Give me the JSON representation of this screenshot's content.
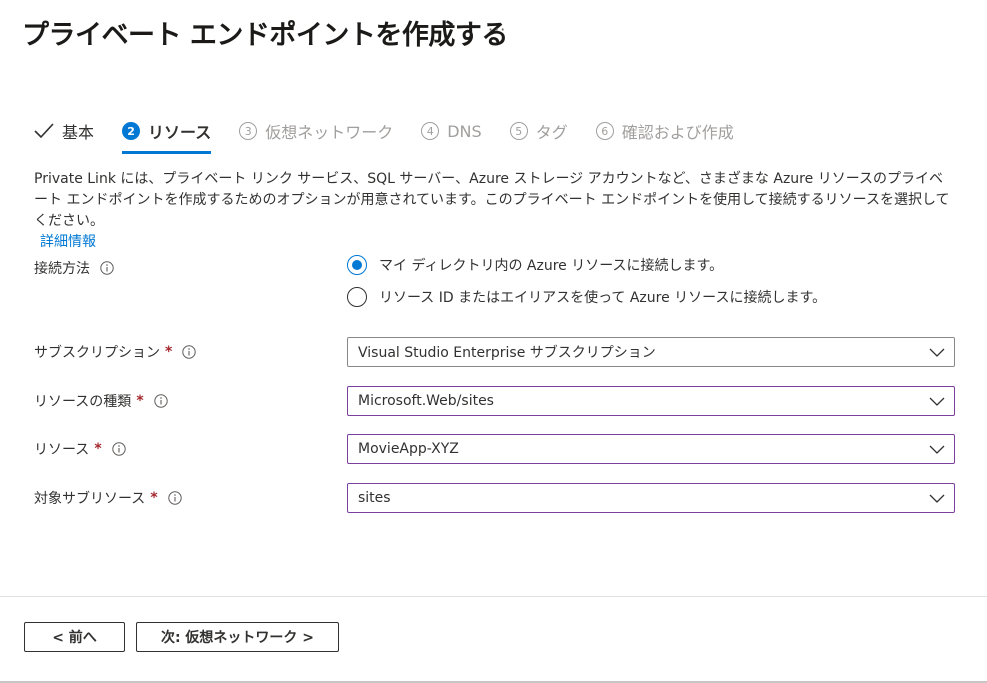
{
  "header": {
    "title": "プライベート エンドポイントを作成する",
    "more_label": "···"
  },
  "tabs": [
    {
      "num": "",
      "label": "基本",
      "state": "done"
    },
    {
      "num": "2",
      "label": "リソース",
      "state": "active"
    },
    {
      "num": "3",
      "label": "仮想ネットワーク",
      "state": "disabled"
    },
    {
      "num": "4",
      "label": "DNS",
      "state": "disabled"
    },
    {
      "num": "5",
      "label": "タグ",
      "state": "disabled"
    },
    {
      "num": "6",
      "label": "確認および作成",
      "state": "disabled"
    }
  ],
  "description": {
    "text": "Private Link には、プライベート リンク サービス、SQL サーバー、Azure ストレージ アカウントなど、さまざまな Azure リソースのプライベート エンドポイントを作成するためのオプションが用意されています。このプライベート エンドポイントを使用して接続するリソースを選択してください。",
    "link": "詳細情報"
  },
  "connection": {
    "label": "接続方法",
    "options": [
      {
        "label": "マイ ディレクトリ内の Azure リソースに接続します。",
        "checked": true
      },
      {
        "label": "リソース ID またはエイリアスを使って Azure リソースに接続します。",
        "checked": false
      }
    ]
  },
  "fields": {
    "subscription": {
      "label": "サブスクリプション",
      "required": "*",
      "value": "Visual Studio Enterprise サブスクリプション"
    },
    "resource_type": {
      "label": "リソースの種類",
      "required": "*",
      "value": "Microsoft.Web/sites"
    },
    "resource": {
      "label": "リソース",
      "required": "*",
      "value": "MovieApp-XYZ"
    },
    "sub_resource": {
      "label": "対象サブリソース",
      "required": "*",
      "value": "sites"
    }
  },
  "footer": {
    "prev_label": "< 前へ",
    "next_label": "次: 仮想ネットワーク >"
  },
  "colors": {
    "accent": "#0078d4",
    "required": "#a4262c",
    "modified_border": "#7b3f9e"
  }
}
